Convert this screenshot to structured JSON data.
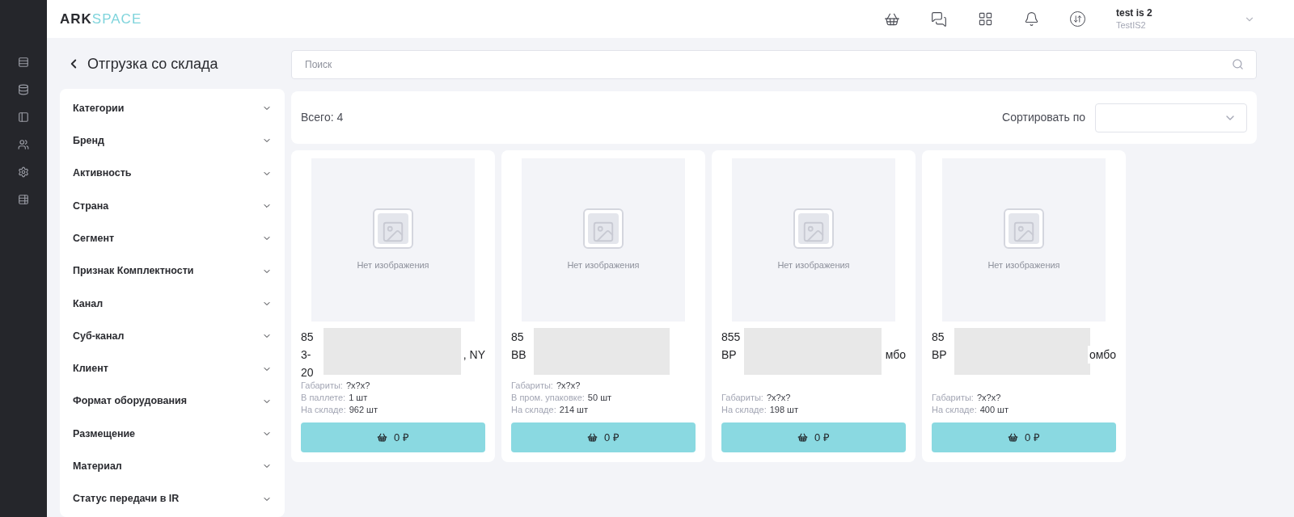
{
  "header": {
    "logo_dark": "ARK",
    "logo_light": "SPACE",
    "user": {
      "name": "test is 2",
      "login": "TestIS2"
    }
  },
  "page": {
    "title": "Отгрузка со склада"
  },
  "search": {
    "placeholder": "Поиск"
  },
  "filters": [
    {
      "label": "Категории",
      "expanded": false
    },
    {
      "label": "Бренд",
      "expanded": false
    },
    {
      "label": "Активность",
      "expanded": false
    },
    {
      "label": "Страна",
      "expanded": false
    },
    {
      "label": "Сегмент",
      "expanded": false
    },
    {
      "label": "Признак Комплектности",
      "expanded": false
    },
    {
      "label": "Канал",
      "expanded": false
    },
    {
      "label": "Суб-канал",
      "expanded": false
    },
    {
      "label": "Клиент",
      "expanded": false
    },
    {
      "label": "Формат оборудования",
      "expanded": false
    },
    {
      "label": "Размещение",
      "expanded": false
    },
    {
      "label": "Материал",
      "expanded": false
    },
    {
      "label": "Статус передачи в IR",
      "expanded": false
    }
  ],
  "toolbar": {
    "total": "Всего: 4",
    "sort_label": "Сортировать по"
  },
  "products": [
    {
      "image_text": "Нет изображения",
      "title_lines": [
        {
          "start": "85"
        },
        {
          "start": "3-",
          "end": ", NY"
        },
        {
          "start": "20"
        }
      ],
      "specs": [
        {
          "label": "Габариты:",
          "value": "?x?x?"
        },
        {
          "label": "В паллете:",
          "value": "1 шт"
        },
        {
          "label": "На складе:",
          "value": "962 шт"
        }
      ],
      "price": "0 ₽"
    },
    {
      "image_text": "Нет изображения",
      "title_lines": [
        {
          "start": "85"
        },
        {
          "start": "BB"
        }
      ],
      "specs": [
        {
          "label": "Габариты:",
          "value": "?x?x?"
        },
        {
          "label": "В пром. упаковке:",
          "value": "50 шт"
        },
        {
          "label": "На складе:",
          "value": "214 шт"
        }
      ],
      "price": "0 ₽"
    },
    {
      "image_text": "Нет изображения",
      "title_lines": [
        {
          "start": "855"
        },
        {
          "start": "BP",
          "end": "мбо"
        }
      ],
      "specs": [
        {
          "label": "Габариты:",
          "value": "?x?x?"
        },
        {
          "label": "На складе:",
          "value": "198 шт"
        }
      ],
      "price": "0 ₽"
    },
    {
      "image_text": "Нет изображения",
      "title_lines": [
        {
          "start": "85"
        },
        {
          "start": "BP",
          "end": "омбо"
        }
      ],
      "specs": [
        {
          "label": "Габариты:",
          "value": "?x?x?"
        },
        {
          "label": "На складе:",
          "value": "400 шт"
        }
      ],
      "price": "0 ₽"
    }
  ]
}
